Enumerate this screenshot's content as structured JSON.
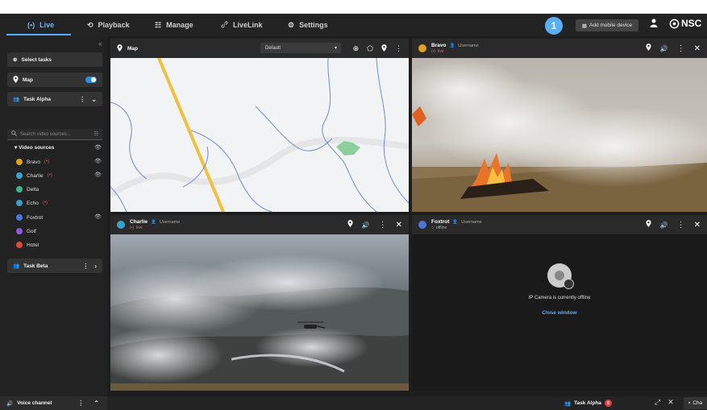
{
  "nav": {
    "tabs": [
      {
        "label": "Live",
        "icon": "live-icon",
        "glyph": "(•)"
      },
      {
        "label": "Playback",
        "icon": "history-icon",
        "glyph": "⟲"
      },
      {
        "label": "Manage",
        "icon": "sliders-icon",
        "glyph": "☷"
      },
      {
        "label": "LiveLink",
        "icon": "link-icon",
        "glyph": "🔗"
      },
      {
        "label": "Settings",
        "icon": "gear-icon",
        "glyph": "⚙"
      }
    ],
    "active_tab": "Live",
    "step_badge": "1",
    "add_mobile_label": "Add mobile device",
    "logo_text": "NSC"
  },
  "sidebar": {
    "select_tasks": "Select tasks",
    "map_label": "Map",
    "map_toggle_on": true,
    "task_alpha": "Task Alpha",
    "search_placeholder": "Search video sources...",
    "video_sources_label": "Video sources",
    "sources": [
      {
        "name": "Bravo",
        "live": true,
        "eye": true,
        "color": "#e0a020"
      },
      {
        "name": "Charlie",
        "live": true,
        "eye": true,
        "color": "#3aa0c8"
      },
      {
        "name": "Delta",
        "live": false,
        "eye": false,
        "color": "#3cb48c"
      },
      {
        "name": "Echo",
        "live": true,
        "eye": false,
        "color": "#3aa0c8"
      },
      {
        "name": "Foxtrot",
        "live": false,
        "eye": true,
        "color": "#4a78d8"
      },
      {
        "name": "Golf",
        "live": false,
        "eye": false,
        "color": "#8a5ad8"
      },
      {
        "name": "Hotel",
        "live": false,
        "eye": false,
        "color": "#e04a3a"
      }
    ],
    "task_beta": "Task Beta"
  },
  "panes": {
    "map": {
      "title": "Map",
      "select_value": "Default"
    },
    "bravo": {
      "title": "Bravo",
      "user": "Username",
      "status": "live"
    },
    "charlie": {
      "title": "Charlie",
      "user": "Username",
      "status": "live"
    },
    "foxtrot": {
      "title": "Foxtrot",
      "user": "Username",
      "status": "offline",
      "offline_message": "IP Camera is currently offline",
      "close_label": "Close window"
    }
  },
  "bottom": {
    "voice_label": "Voice channel",
    "task_label": "Task Alpha",
    "task_count": "6",
    "chat_label": "Cha"
  },
  "colors": {
    "accent": "#5ab0f2",
    "live": "#e05050",
    "toggle": "#2e8de0"
  }
}
